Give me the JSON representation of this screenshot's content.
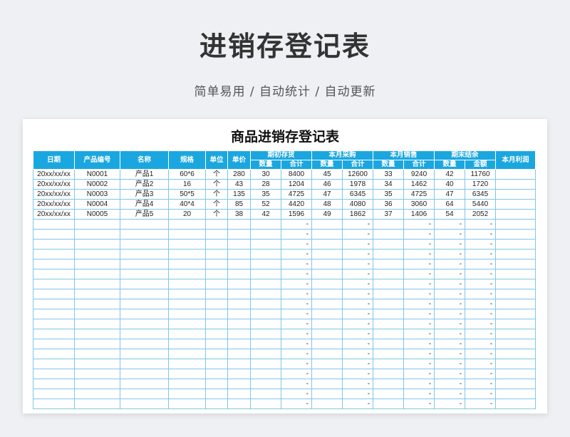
{
  "page": {
    "title": "进销存登记表",
    "subtitle": "简单易用 / 自动统计 / 自动更新"
  },
  "sheet": {
    "title": "商品进销存登记表",
    "headers": {
      "date": "日期",
      "code": "产品编号",
      "name": "名称",
      "spec": "规格",
      "unit": "单位",
      "price": "单价",
      "opening": "期初存货",
      "purchase": "本月采购",
      "sales": "本月销售",
      "closing": "期末结余",
      "profit": "本月利润",
      "qty": "数量",
      "total": "合计",
      "amount": "金额"
    },
    "rows": [
      [
        "20xx/xx/xx",
        "N0001",
        "产品1",
        "60*6",
        "个",
        "280",
        "30",
        "8400",
        "45",
        "12600",
        "33",
        "9240",
        "42",
        "11760",
        ""
      ],
      [
        "20xx/xx/xx",
        "N0002",
        "产品2",
        "16",
        "个",
        "43",
        "28",
        "1204",
        "46",
        "1978",
        "34",
        "1462",
        "40",
        "1720",
        ""
      ],
      [
        "20xx/xx/xx",
        "N0003",
        "产品3",
        "50*5",
        "个",
        "135",
        "35",
        "4725",
        "47",
        "6345",
        "35",
        "4725",
        "47",
        "6345",
        ""
      ],
      [
        "20xx/xx/xx",
        "N0004",
        "产品4",
        "40*4",
        "个",
        "85",
        "52",
        "4420",
        "48",
        "4080",
        "36",
        "3060",
        "64",
        "5440",
        ""
      ],
      [
        "20xx/xx/xx",
        "N0005",
        "产品5",
        "20",
        "个",
        "38",
        "42",
        "1596",
        "49",
        "1862",
        "37",
        "1406",
        "54",
        "2052",
        ""
      ]
    ],
    "empty_row_marker": "-",
    "empty_row_count": 19
  }
}
